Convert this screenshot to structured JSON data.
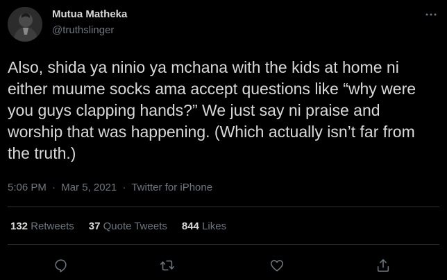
{
  "user": {
    "display_name": "Mutua Matheka",
    "handle": "@truthslinger",
    "avatar_icon": "profile-photo"
  },
  "tweet": {
    "text": "Also, shida ya ninio ya mchana with the kids at home ni either muume socks ama accept questions like “why were you guys clapping hands?” We just say ni praise and worship that was happening. (Which actually isn’t far from the truth.)",
    "time": "5:06 PM",
    "date": "Mar 5, 2021",
    "separator": "·",
    "source": "Twitter for iPhone"
  },
  "stats": {
    "retweets_count": "132",
    "retweets_label": "Retweets",
    "quotes_count": "37",
    "quotes_label": "Quote Tweets",
    "likes_count": "844",
    "likes_label": "Likes"
  },
  "icons": {
    "more": "more-dots-icon",
    "reply": "reply-icon",
    "retweet": "retweet-icon",
    "like": "heart-icon",
    "share": "share-icon"
  },
  "colors": {
    "background": "#000000",
    "text_primary": "#d9d9d9",
    "text_secondary": "#6e767d",
    "divider": "#2f3336"
  }
}
